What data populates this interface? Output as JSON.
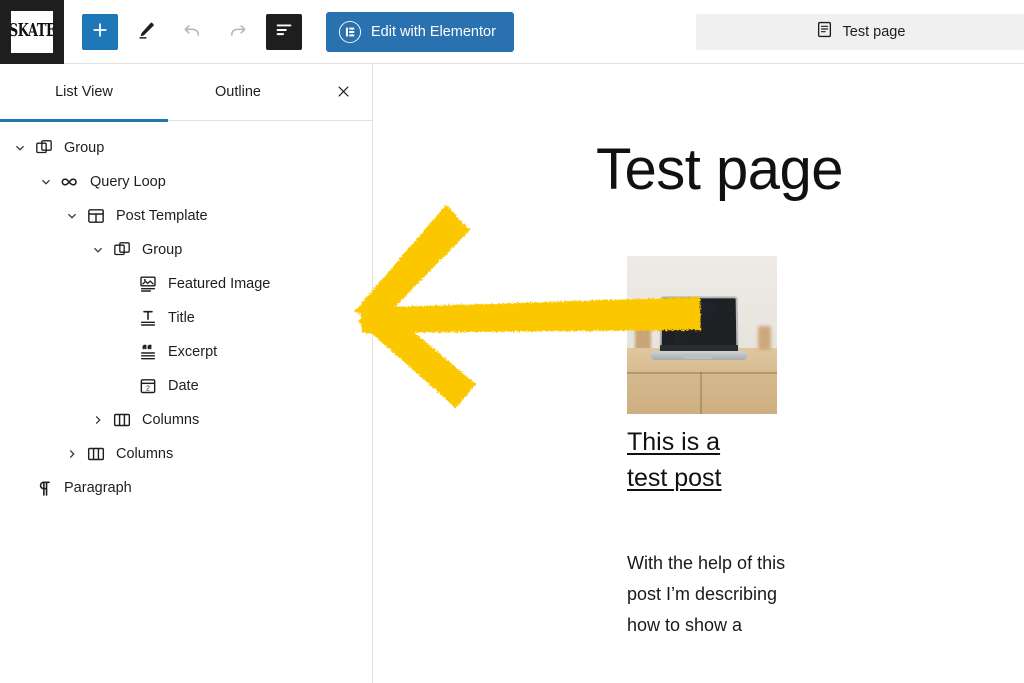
{
  "topbar": {
    "logo_text": "SKATE",
    "logo_name": "site-logo",
    "buttons": [
      {
        "name": "add-block-button",
        "label": "Add block",
        "icon": "plus-icon"
      },
      {
        "name": "tools-pencil-button",
        "label": "Tools",
        "icon": "pencil-icon"
      },
      {
        "name": "undo-button",
        "label": "Undo",
        "icon": "undo-icon",
        "disabled": true
      },
      {
        "name": "redo-button",
        "label": "Redo",
        "icon": "redo-icon",
        "disabled": true
      },
      {
        "name": "list-view-toggle",
        "label": "Document Overview",
        "icon": "list-view-icon",
        "active": true
      }
    ],
    "elementor_button": {
      "label": "Edit with Elementor",
      "icon": "elementor-logo-icon",
      "bg_color": "#2a71b0"
    },
    "document_bar": {
      "title": "Test page",
      "icon": "page-document-icon"
    }
  },
  "sidebar": {
    "tabs": [
      {
        "label": "List View",
        "active": true
      },
      {
        "label": "Outline",
        "active": false
      }
    ],
    "close_label": "Close",
    "close_icon": "close-icon",
    "accent_color": "#1e77b6",
    "tree": [
      {
        "label": "Group",
        "icon": "group-icon",
        "depth": 0,
        "chevron": "down"
      },
      {
        "label": "Query Loop",
        "icon": "query-loop-icon",
        "depth": 1,
        "chevron": "down"
      },
      {
        "label": "Post Template",
        "icon": "post-template-icon",
        "depth": 2,
        "chevron": "down"
      },
      {
        "label": "Group",
        "icon": "group-icon",
        "depth": 3,
        "chevron": "down"
      },
      {
        "label": "Featured Image",
        "icon": "featured-image-icon",
        "depth": 4,
        "chevron": "none"
      },
      {
        "label": "Title",
        "icon": "title-icon",
        "depth": 4,
        "chevron": "none"
      },
      {
        "label": "Excerpt",
        "icon": "excerpt-icon",
        "depth": 4,
        "chevron": "none"
      },
      {
        "label": "Date",
        "icon": "date-icon",
        "depth": 4,
        "chevron": "none"
      },
      {
        "label": "Columns",
        "icon": "columns-icon",
        "depth": 3,
        "chevron": "right"
      },
      {
        "label": "Columns",
        "icon": "columns-icon",
        "depth": 2,
        "chevron": "right"
      },
      {
        "label": "Paragraph",
        "icon": "paragraph-icon",
        "depth": 0,
        "chevron": "none"
      }
    ]
  },
  "canvas": {
    "page_title": "Test page",
    "post": {
      "featured_image_alt": "Laptop on a wooden desk",
      "title_line_1": "This is a",
      "title_line_2": "test post",
      "excerpt": "With the help of this post I’m describing how to show a"
    }
  },
  "annotation": {
    "arrow_color": "#fbc800",
    "arrow_direction": "left",
    "arrow_name": "yellow-brush-arrow"
  }
}
